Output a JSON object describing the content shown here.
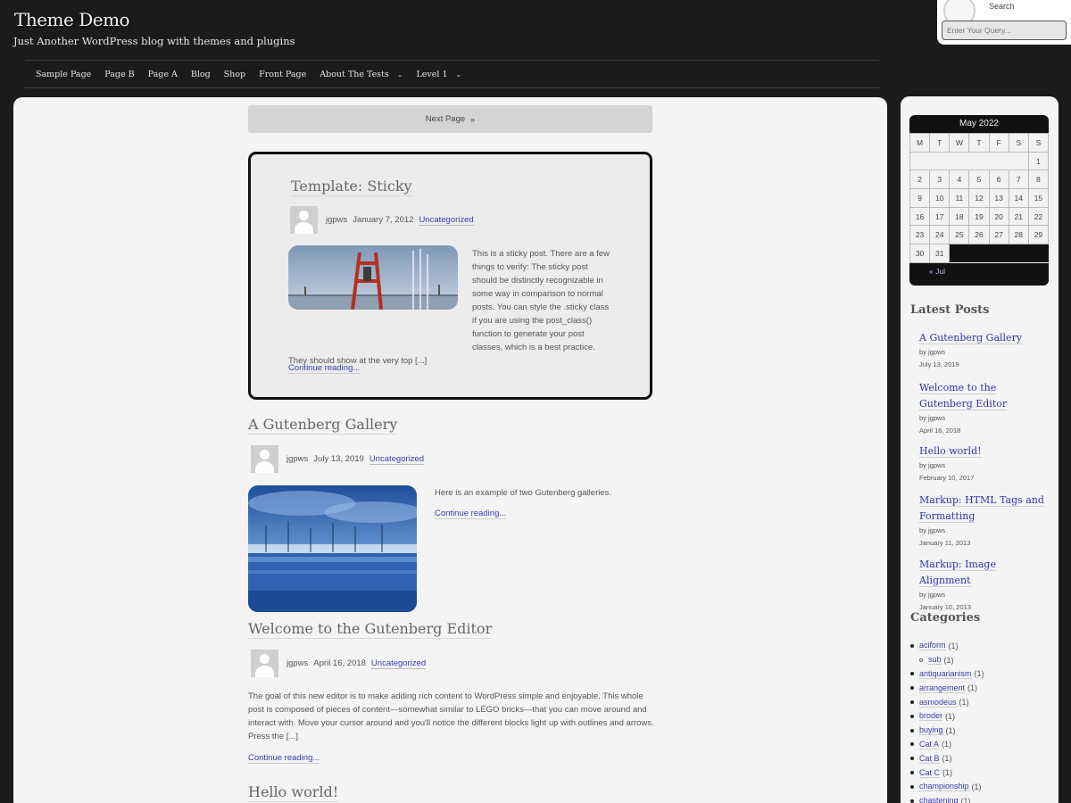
{
  "header": {
    "title": "Theme Demo",
    "description": "Just Another WordPress blog with themes and plugins"
  },
  "nav": [
    {
      "label": "Sample Page",
      "has_children": false
    },
    {
      "label": "Page B",
      "has_children": false
    },
    {
      "label": "Page A",
      "has_children": false
    },
    {
      "label": "Blog",
      "has_children": false
    },
    {
      "label": "Shop",
      "has_children": false
    },
    {
      "label": "Front Page",
      "has_children": false
    },
    {
      "label": "About The Tests",
      "has_children": true
    },
    {
      "label": "Level 1",
      "has_children": true
    }
  ],
  "search": {
    "label": "Search",
    "placeholder": "Enter Your Query..."
  },
  "pagination": {
    "next_label": "Next Page",
    "next_icon": "»"
  },
  "posts": [
    {
      "title": "Template: Sticky",
      "author": "jgpws",
      "date": "January 7, 2012",
      "category": "Uncategorized",
      "excerpt": "This is a sticky post. There are a few things to verify: The sticky post should be distinctly recognizable in some way in comparison to normal posts. You can style the .sticky class if you are using the post_class() function to generate your post classes, which is a best practice. They should show at the very top [...]",
      "more": "Continue reading..."
    },
    {
      "title": "A Gutenberg Gallery",
      "author": "jgpws",
      "date": "July 13, 2019",
      "category": "Uncategorized",
      "excerpt": "Here is an example of two Gutenberg galleries.",
      "more": "Continue reading..."
    },
    {
      "title": "Welcome to the Gutenberg Editor",
      "author": "jgpws",
      "date": "April 16, 2018",
      "category": "Uncategorized",
      "excerpt": "The goal of this new editor is to make adding rich content to WordPress simple and enjoyable. This whole post is composed of pieces of content—somewhat similar to LEGO bricks—that you can move around and interact with. Move your cursor around and you'll notice the different blocks light up with outlines and arrows. Press the [...]",
      "more": "Continue reading..."
    },
    {
      "title": "Hello world!"
    }
  ],
  "calendar": {
    "caption": "May 2022",
    "weekdays": [
      "M",
      "T",
      "W",
      "T",
      "F",
      "S",
      "S"
    ],
    "weeks": [
      [
        "",
        "",
        "",
        "",
        "",
        "",
        "1"
      ],
      [
        "2",
        "3",
        "4",
        "5",
        "6",
        "7",
        "8"
      ],
      [
        "9",
        "10",
        "11",
        "12",
        "13",
        "14",
        "15"
      ],
      [
        "16",
        "17",
        "18",
        "19",
        "20",
        "21",
        "22"
      ],
      [
        "23",
        "24",
        "25",
        "26",
        "27",
        "28",
        "29"
      ],
      [
        "30",
        "31",
        "",
        "",
        "",
        "",
        ""
      ]
    ],
    "prev": "« Jul"
  },
  "latest_posts": {
    "title": "Latest Posts",
    "items": [
      {
        "title": "A Gutenberg Gallery",
        "by": "by jgpws",
        "date": "July 13, 2019"
      },
      {
        "title": "Welcome to the Gutenberg Editor",
        "by": "by jgpws",
        "date": "April 16, 2018"
      },
      {
        "title": "Hello world!",
        "by": "by jgpws",
        "date": "February 10, 2017"
      },
      {
        "title": "Markup: HTML Tags and Formatting",
        "by": "by jgpws",
        "date": "January 11, 2013"
      },
      {
        "title": "Markup: Image Alignment",
        "by": "by jgpws",
        "date": "January 10, 2013"
      }
    ]
  },
  "categories": {
    "title": "Categories",
    "items": [
      {
        "name": "aciform",
        "count": "(1)",
        "sub": false
      },
      {
        "name": "sub",
        "count": "(1)",
        "sub": true
      },
      {
        "name": "antiquarianism",
        "count": "(1)",
        "sub": false
      },
      {
        "name": "arrangement",
        "count": "(1)",
        "sub": false
      },
      {
        "name": "asmodeus",
        "count": "(1)",
        "sub": false
      },
      {
        "name": "broder",
        "count": "(1)",
        "sub": false
      },
      {
        "name": "buying",
        "count": "(1)",
        "sub": false
      },
      {
        "name": "Cat A",
        "count": "(1)",
        "sub": false
      },
      {
        "name": "Cat B",
        "count": "(1)",
        "sub": false
      },
      {
        "name": "Cat C",
        "count": "(1)",
        "sub": false
      },
      {
        "name": "championship",
        "count": "(1)",
        "sub": false
      },
      {
        "name": "chastening",
        "count": "(1)",
        "sub": false
      }
    ]
  }
}
